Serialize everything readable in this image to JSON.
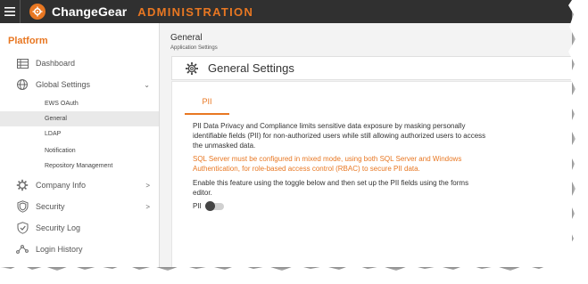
{
  "topbar": {
    "brand": "ChangeGear",
    "section": "ADMINISTRATION"
  },
  "sidebar": {
    "title": "Platform",
    "items": [
      {
        "label": "Dashboard",
        "icon": "dashboard-icon"
      },
      {
        "label": "Global Settings",
        "icon": "globe-settings-icon",
        "arrow": "⌄"
      },
      {
        "label": "Company Info",
        "icon": "gear-icon",
        "arrow": ">"
      },
      {
        "label": "Security",
        "icon": "shield-icon",
        "arrow": ">"
      },
      {
        "label": "Security Log",
        "icon": "shield-check-icon"
      },
      {
        "label": "Login History",
        "icon": "login-history-icon"
      }
    ],
    "subitems": [
      {
        "label": "EWS OAuth"
      },
      {
        "label": "General",
        "active": true
      },
      {
        "label": "LDAP"
      },
      {
        "label": "Notification"
      },
      {
        "label": "Repository Management"
      }
    ]
  },
  "main": {
    "breadcrumb_title": "General",
    "breadcrumb_sub": "Application Settings",
    "header": "General Settings",
    "tab": "PII",
    "para1": "PII Data Privacy and Compliance limits sensitive data exposure by masking personally identifiable fields (PII) for non-authorized users while still allowing authorized users to access the unmasked data.",
    "para2": "SQL Server must be configured in mixed mode, using both SQL Server and Windows Authentication, for role-based access control (RBAC) to secure PII data.",
    "para3": "Enable this feature using the toggle below and then set up the PII fields using the forms editor.",
    "toggle_label": "PII",
    "toggle_on": false
  },
  "colors": {
    "accent": "#e87722",
    "topbar": "#303030"
  }
}
